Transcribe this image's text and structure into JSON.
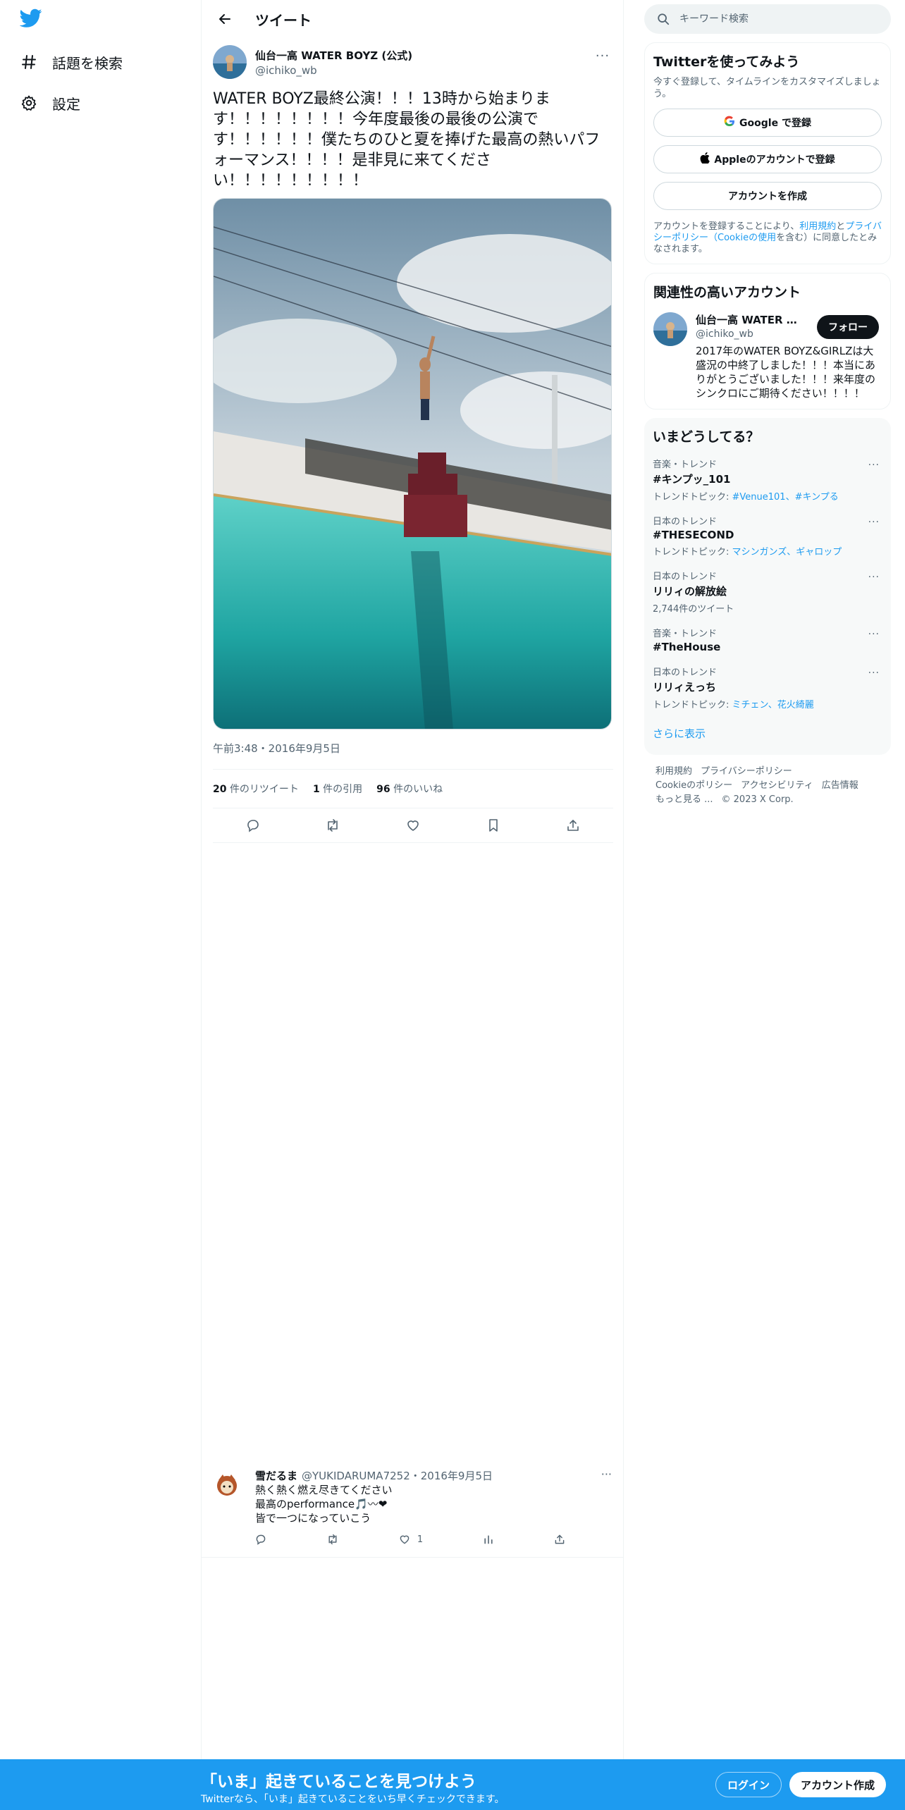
{
  "nav": {
    "logo_icon": "twitter-bird-icon",
    "items": [
      {
        "icon": "hashtag-icon",
        "label": "話題を検索"
      },
      {
        "icon": "gear-icon",
        "label": "設定"
      }
    ]
  },
  "header": {
    "title": "ツイート"
  },
  "tweet": {
    "author_name": "仙台一高 WATER BOYZ (公式)",
    "author_handle": "@ichiko_wb",
    "text": "WATER BOYZ最終公演！！！13時から始まります！！！！！！！！今年度最後の最後の公演です！！！！！！僕たちのひと夏を捧げた最高の熱いパフォーマンス！！！！是非見に来てください！！！！！！！！！",
    "timestamp": "午前3:48・2016年9月5日",
    "stats": {
      "retweets_count": "20",
      "retweets_label": "件のリツイート",
      "quotes_count": "1",
      "quotes_label": "件の引用",
      "likes_count": "96",
      "likes_label": "件のいいね"
    }
  },
  "reply": {
    "name": "雪だるま",
    "handle_date": "@YUKIDARUMA7252・2016年9月5日",
    "lines": [
      "熱く熱く燃え尽きてください",
      "最高のperformance🎵〰❤",
      "皆で一つになっていこう"
    ],
    "like_count": "1"
  },
  "search": {
    "placeholder": "キーワード検索"
  },
  "signup_panel": {
    "title": "Twitterを使ってみよう",
    "subtitle": "今すぐ登録して、タイムラインをカスタマイズしましょう。",
    "google_button": "Google で登録",
    "apple_button": "Appleのアカウントで登録",
    "create_button": "アカウントを作成",
    "legal_prefix": "アカウントを登録することにより、",
    "legal_terms": "利用規約",
    "legal_and": "と",
    "legal_privacy": "プライバシーポリシー（Cookieの使用",
    "legal_suffix": "を含む）に同意したとみなされます。"
  },
  "related": {
    "title": "関連性の高いアカウント",
    "name": "仙台一高 WATER BOYZ (公式)",
    "handle": "@ichiko_wb",
    "bio": "2017年のWATER BOYZ&GIRLZは大盛況の中終了しました！！！本当にありがとうございました！！！来年度のシンクロにご期待ください！！！！",
    "follow_label": "フォロー"
  },
  "trends": {
    "title": "いまどうしてる？",
    "items": [
      {
        "category": "音楽・トレンド",
        "name": "#キンプッ_101",
        "sub_prefix": "トレンドトピック: ",
        "sub_links": "#Venue101、#キンプる"
      },
      {
        "category": "日本のトレンド",
        "name": "#THESECOND",
        "sub_prefix": "トレンドトピック: ",
        "sub_links": "マシンガンズ、ギャロップ"
      },
      {
        "category": "日本のトレンド",
        "name": "リリィの解放絵",
        "sub_prefix": "2,744件のツイート",
        "sub_links": ""
      },
      {
        "category": "音楽・トレンド",
        "name": "#TheHouse",
        "sub_prefix": "",
        "sub_links": ""
      },
      {
        "category": "日本のトレンド",
        "name": "リリィえっち",
        "sub_prefix": "トレンドトピック: ",
        "sub_links": "ミチェン、花火綺麗"
      }
    ],
    "show_more": "さらに表示"
  },
  "footer": {
    "links": [
      "利用規約",
      "プライバシーポリシー",
      "Cookieのポリシー",
      "アクセシビリティ",
      "広告情報",
      "もっと見る ..."
    ],
    "copyright": "© 2023 X Corp."
  },
  "bottom_bar": {
    "title": "「いま」起きていることを見つけよう",
    "subtitle": "Twitterなら、「いま」起きていることをいち早くチェックできます。",
    "login": "ログイン",
    "signup": "アカウント作成"
  },
  "colors": {
    "accent": "#1d9bf0",
    "text": "#0f1419",
    "secondary": "#536471",
    "border": "#eff3f4"
  }
}
